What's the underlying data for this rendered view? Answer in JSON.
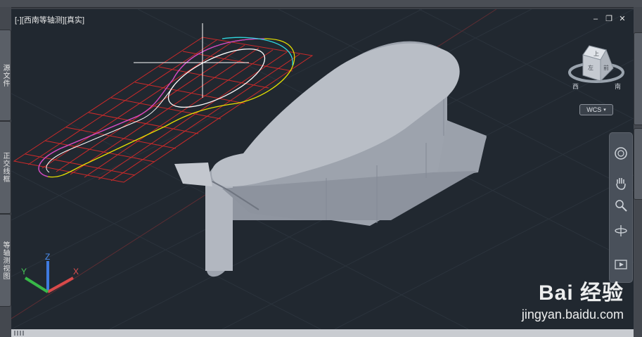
{
  "viewport": {
    "label": "[-][西南等轴测][真实]"
  },
  "window_controls": {
    "minimize": "‒",
    "restore": "❐",
    "close": "✕"
  },
  "left_tabs": [
    "源文件",
    "正交线框",
    "等轴测视图"
  ],
  "viewcube": {
    "top": "上",
    "left_face": "左",
    "front_face": "前",
    "compass_west": "西",
    "compass_south": "南",
    "wcs_label": "WCS"
  },
  "ucs_icon": {
    "x": "X",
    "y": "Y",
    "z": "Z"
  },
  "navbar_tools": [
    "steering-wheel-icon",
    "pan-hand-icon",
    "zoom-icon",
    "orbit-icon",
    "showmotion-icon"
  ],
  "watermark": {
    "brand": "Bai 经验",
    "url": "jingyan.baidu.com"
  },
  "colors": {
    "viewport_bg": "#212830",
    "solid_fill": "#a7acb6",
    "profile_red": "#cc2a2a",
    "highlight_white": "#ffffff"
  }
}
